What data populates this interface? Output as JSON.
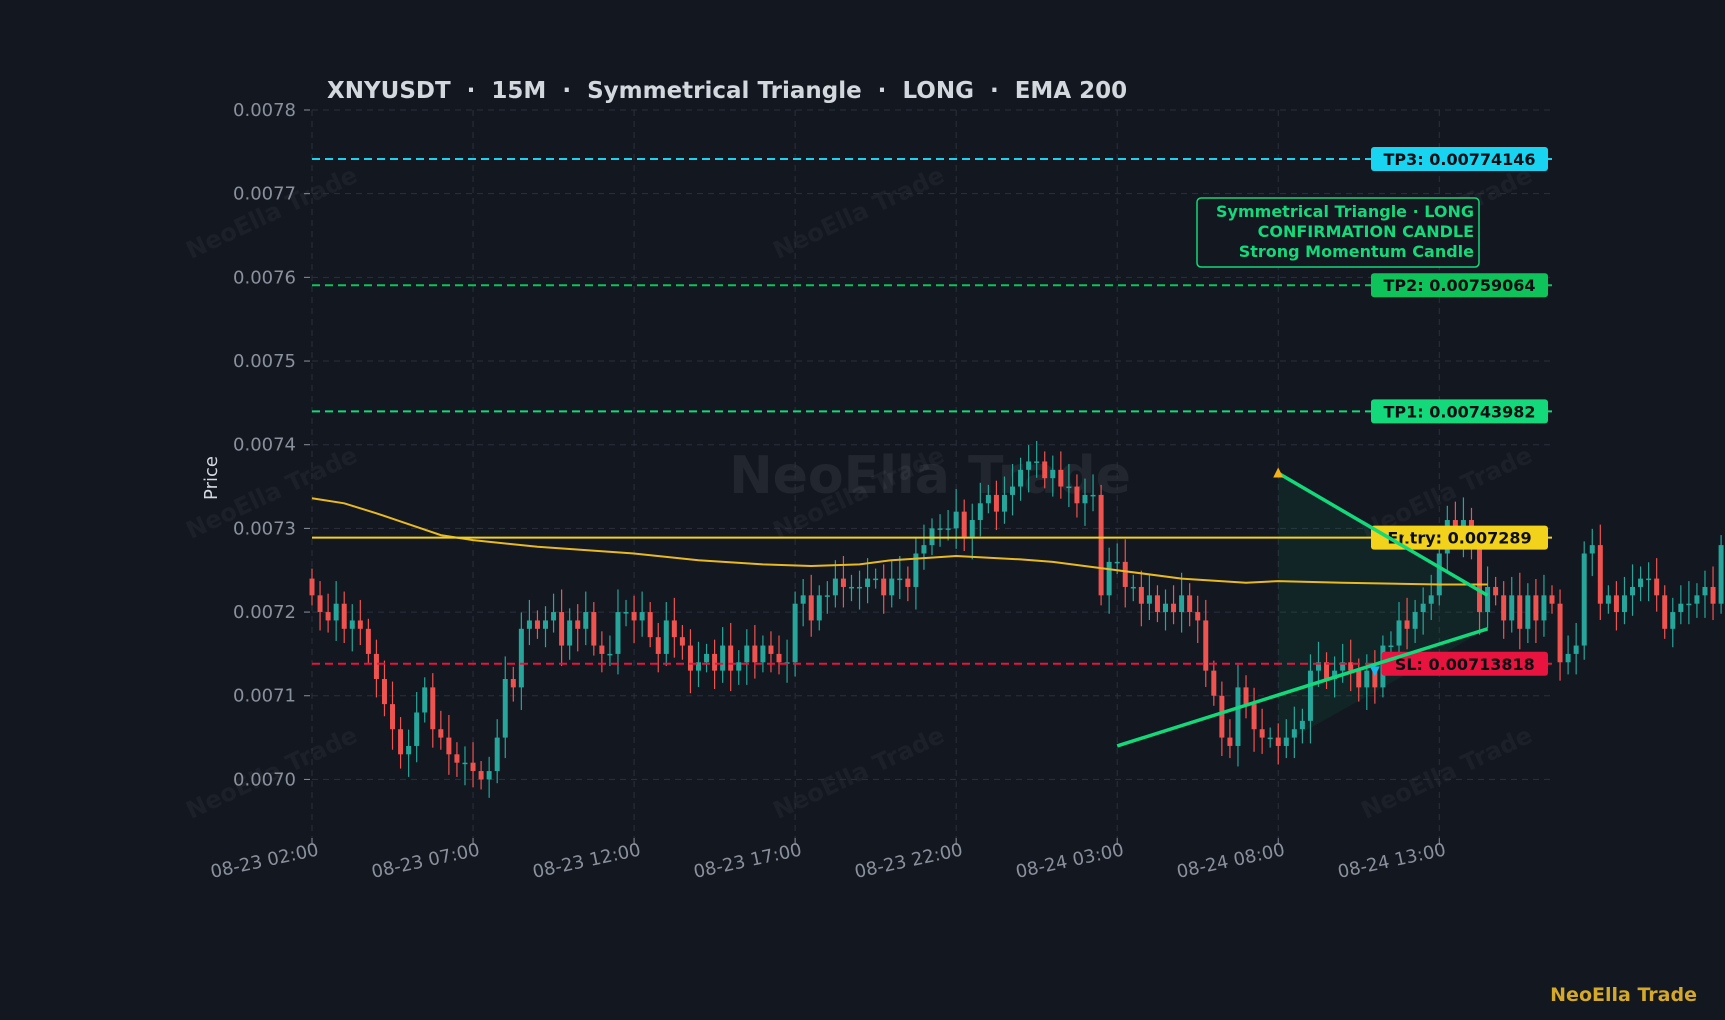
{
  "chart_data": {
    "type": "candlestick",
    "title": "XNYUSDT  ·  15M  ·  Symmetrical Triangle  ·  LONG  ·  EMA 200",
    "ylabel": "Price",
    "xlabel": "",
    "ylim": [
      0.00693,
      0.0078
    ],
    "x_range": [
      "2025-08-23T02:00",
      "2025-08-24T16:30"
    ],
    "y_ticks": [
      "0.0070",
      "0.0071",
      "0.0072",
      "0.0073",
      "0.0074",
      "0.0075",
      "0.0076",
      "0.0077",
      "0.0078"
    ],
    "x_ticks": [
      {
        "t": "2025-08-23T02:00",
        "label": "08-23 02:00"
      },
      {
        "t": "2025-08-23T07:00",
        "label": "08-23 07:00"
      },
      {
        "t": "2025-08-23T12:00",
        "label": "08-23 12:00"
      },
      {
        "t": "2025-08-23T17:00",
        "label": "08-23 17:00"
      },
      {
        "t": "2025-08-23T22:00",
        "label": "08-23 22:00"
      },
      {
        "t": "2025-08-24T03:00",
        "label": "08-24 03:00"
      },
      {
        "t": "2025-08-24T08:00",
        "label": "08-24 08:00"
      },
      {
        "t": "2025-08-24T13:00",
        "label": "08-24 13:00"
      }
    ],
    "grid": true,
    "candle_interval_min": 15,
    "first_candle_time": "2025-08-23T02:00",
    "candles_close": [
      0.00722,
      0.0072,
      0.00719,
      0.00721,
      0.00718,
      0.00719,
      0.00718,
      0.00715,
      0.00712,
      0.00709,
      0.00706,
      0.00703,
      0.00704,
      0.00708,
      0.00711,
      0.00706,
      0.00705,
      0.00703,
      0.00702,
      0.00702,
      0.00701,
      0.007,
      0.00701,
      0.00705,
      0.00712,
      0.00711,
      0.00718,
      0.00719,
      0.00718,
      0.00719,
      0.0072,
      0.00716,
      0.00719,
      0.00718,
      0.0072,
      0.00716,
      0.00715,
      0.00715,
      0.0072,
      0.0072,
      0.00719,
      0.0072,
      0.00717,
      0.00715,
      0.00719,
      0.00717,
      0.00716,
      0.00713,
      0.00714,
      0.00715,
      0.00713,
      0.00716,
      0.00713,
      0.00714,
      0.00716,
      0.00714,
      0.00716,
      0.00715,
      0.00714,
      0.00714,
      0.00721,
      0.00722,
      0.00719,
      0.00722,
      0.00722,
      0.00724,
      0.00723,
      0.00723,
      0.00723,
      0.00724,
      0.00724,
      0.00722,
      0.00724,
      0.00724,
      0.00723,
      0.00727,
      0.00728,
      0.0073,
      0.0073,
      0.0073,
      0.00732,
      0.00729,
      0.00731,
      0.00733,
      0.00734,
      0.00732,
      0.00734,
      0.00735,
      0.00737,
      0.00738,
      0.00738,
      0.00736,
      0.00737,
      0.00735,
      0.00735,
      0.00733,
      0.00734,
      0.00734,
      0.00722,
      0.00726,
      0.00726,
      0.00723,
      0.00723,
      0.00721,
      0.00722,
      0.0072,
      0.00721,
      0.0072,
      0.00722,
      0.0072,
      0.00719,
      0.00713,
      0.0071,
      0.00705,
      0.00704,
      0.00711,
      0.00709,
      0.00706,
      0.00705,
      0.00705,
      0.00704,
      0.00705,
      0.00706,
      0.00707,
      0.00713,
      0.00714,
      0.00712,
      0.00713,
      0.00714,
      0.00713,
      0.00711,
      0.00713,
      0.00711,
      0.00716,
      0.00716,
      0.00719,
      0.00718,
      0.0072,
      0.00721,
      0.00722,
      0.00727,
      0.00731,
      0.00729,
      0.00731,
      0.00728,
      0.0072,
      0.00723,
      0.00722,
      0.00719,
      0.00722,
      0.00718,
      0.00722,
      0.00719,
      0.00722,
      0.00721,
      0.00714,
      0.00715,
      0.00716,
      0.00727,
      0.00728,
      0.00721,
      0.00722,
      0.0072,
      0.00722,
      0.00723,
      0.00724,
      0.00724,
      0.00722,
      0.00718,
      0.0072,
      0.00721,
      0.00721,
      0.00722,
      0.00723,
      0.00721,
      0.00728
    ],
    "ema200": [
      {
        "t": "2025-08-23T02:00",
        "v": 0.007336
      },
      {
        "t": "2025-08-23T03:00",
        "v": 0.00733
      },
      {
        "t": "2025-08-23T04:00",
        "v": 0.007318
      },
      {
        "t": "2025-08-23T05:00",
        "v": 0.007305
      },
      {
        "t": "2025-08-23T06:00",
        "v": 0.007292
      },
      {
        "t": "2025-08-23T07:00",
        "v": 0.007286
      },
      {
        "t": "2025-08-23T09:00",
        "v": 0.007278
      },
      {
        "t": "2025-08-23T12:00",
        "v": 0.00727
      },
      {
        "t": "2025-08-23T14:00",
        "v": 0.007262
      },
      {
        "t": "2025-08-23T16:00",
        "v": 0.007257
      },
      {
        "t": "2025-08-23T17:30",
        "v": 0.007255
      },
      {
        "t": "2025-08-23T19:00",
        "v": 0.007257
      },
      {
        "t": "2025-08-23T20:00",
        "v": 0.007262
      },
      {
        "t": "2025-08-23T22:00",
        "v": 0.007267
      },
      {
        "t": "2025-08-24T00:00",
        "v": 0.007263
      },
      {
        "t": "2025-08-24T01:00",
        "v": 0.00726
      },
      {
        "t": "2025-08-24T03:00",
        "v": 0.00725
      },
      {
        "t": "2025-08-24T05:00",
        "v": 0.00724
      },
      {
        "t": "2025-08-24T07:00",
        "v": 0.007235
      },
      {
        "t": "2025-08-24T08:00",
        "v": 0.007237
      },
      {
        "t": "2025-08-24T10:00",
        "v": 0.007235
      },
      {
        "t": "2025-08-24T13:00",
        "v": 0.007233
      },
      {
        "t": "2025-08-24T14:30",
        "v": 0.007233
      }
    ],
    "levels": [
      {
        "name": "TP3",
        "label": "TP3: 0.00774146",
        "value": 0.00774146,
        "color": "#19d4f0",
        "style": "dashed"
      },
      {
        "name": "TP2",
        "label": "TP2: 0.00759064",
        "value": 0.00759064,
        "color": "#0ec45a",
        "style": "dashed"
      },
      {
        "name": "TP1",
        "label": "TP1: 0.00743982",
        "value": 0.00743982,
        "color": "#13d97a",
        "style": "dashed"
      },
      {
        "name": "Entry",
        "label": "Entry: 0.007289",
        "value": 0.007289,
        "color": "#f2d21a",
        "style": "solid"
      },
      {
        "name": "SL",
        "label": "SL: 0.00713818",
        "value": 0.00713818,
        "color": "#e8143f",
        "style": "dashed"
      }
    ],
    "triangle": {
      "upper": [
        {
          "t": "2025-08-24T08:00",
          "v": 0.007366
        },
        {
          "t": "2025-08-24T14:30",
          "v": 0.00722
        }
      ],
      "lower": [
        {
          "t": "2025-08-24T03:00",
          "v": 0.00704
        },
        {
          "t": "2025-08-24T14:30",
          "v": 0.00718
        }
      ],
      "color": "#13d97a"
    },
    "markers": [
      {
        "t": "2025-08-24T08:00",
        "v": 0.007368,
        "kind": "up",
        "color": "#f2b01a"
      },
      {
        "t": "2025-08-24T11:00",
        "v": 0.007128,
        "kind": "down",
        "color": "#19b8f0"
      },
      {
        "t": "2025-08-24T12:00",
        "v": 0.007289,
        "kind": "dot",
        "color": "#f2d21a"
      }
    ],
    "annotation": {
      "lines": [
        "Symmetrical Triangle · LONG",
        "CONFIRMATION CANDLE",
        "Strong Momentum Candle"
      ],
      "color": "#13d97a"
    },
    "watermark": "NeoElla Trade",
    "colors": {
      "up": "#26a69a",
      "down": "#ef5350",
      "ema": "#e8b923",
      "grid": "#2b313c"
    }
  },
  "brand": "NeoElla Trade"
}
